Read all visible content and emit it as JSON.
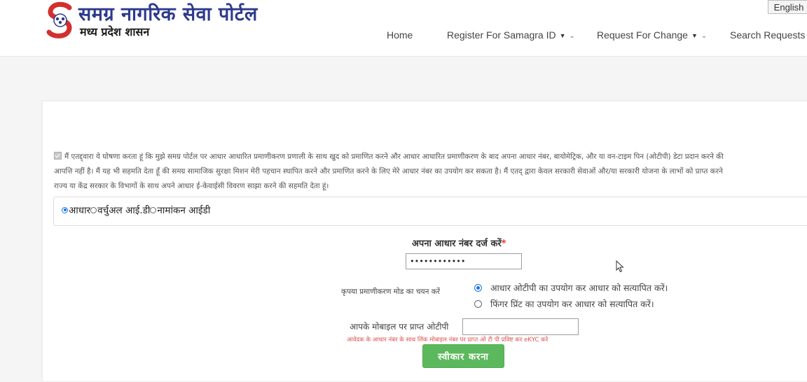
{
  "header": {
    "title": "समग्र नागरिक सेवा पोर्टल",
    "subtitle": "मध्य प्रदेश शासन",
    "language_button": "English",
    "nav": [
      {
        "label": "Home",
        "has_dropdown": false
      },
      {
        "label": "Register For Samagra ID",
        "has_dropdown": true
      },
      {
        "label": "Request For Change",
        "has_dropdown": true
      },
      {
        "label": "Search Requests",
        "has_dropdown": false
      }
    ]
  },
  "consent": {
    "checked": true,
    "lines": [
      "मैं एतद्द्वारा ये घोषणा करता हूं कि मुझे समग्र पोर्टल पर आधार आधारित प्रमाणीकरण प्रणाली के साथ खुद को प्रमाणित करने और आधार आधारित प्रमाणीकरण के बाद अपना आधार नंबर, बायोमेट्रिक, और या वन-टाइम पिन (ओटीपी) डेटा प्रदान करने की",
      "आपत्ति नहीं है। मैं यह भी सहमति देता हूँ की समग्र सामाजिक सुरक्षा मिशन मेरी पहचान स्थापित करने और प्रमाणित करने के लिए मेरे आधार नंबर का उपयोग कर सकता है। मैं एतद् द्वारा केवल सरकारी सेवाओं और/या सरकारी योजना के लाभों को प्राप्त करने",
      "राज्य या केंद्र सरकार के विभागों के साथ अपने आधार ई-केवाईसी विवरण साझा करने की सहमति देता हूं।"
    ]
  },
  "id_type": {
    "options": [
      "आधार",
      "वर्चुअल आई.डी",
      "नामांकन आईडी"
    ],
    "selected_index": 0
  },
  "aadhaar": {
    "label": "अपना आधार नंबर दर्ज करें",
    "required_mark": "*",
    "value": "••••••••••••"
  },
  "auth_mode": {
    "label": "कृपया प्रमाणीकरण मोड का चयन करें",
    "options": [
      "आधार ओटीपी का उपयोग कर आधार को सत्यापित करें।",
      "फिंगर प्रिंट का उपयोग कर आधार को सत्यापित करें।"
    ],
    "selected_index": 0
  },
  "otp": {
    "label": "आपके मोबाइल पर प्राप्त ओटीपी",
    "value": "",
    "hint": "आवेदक के आधार नंबर के साथ लिंक मोबाइल नंबर पर प्राप्त ओ टी पी प्रविष्ट कर eKYC करे"
  },
  "submit_label": "स्वीकार करना",
  "colors": {
    "brand_blue": "#2d3a8c",
    "logo_red": "#d32f2f",
    "accent_blue": "#1a73e8",
    "button_green": "#5cb85c",
    "hint_red": "#d9534f"
  }
}
